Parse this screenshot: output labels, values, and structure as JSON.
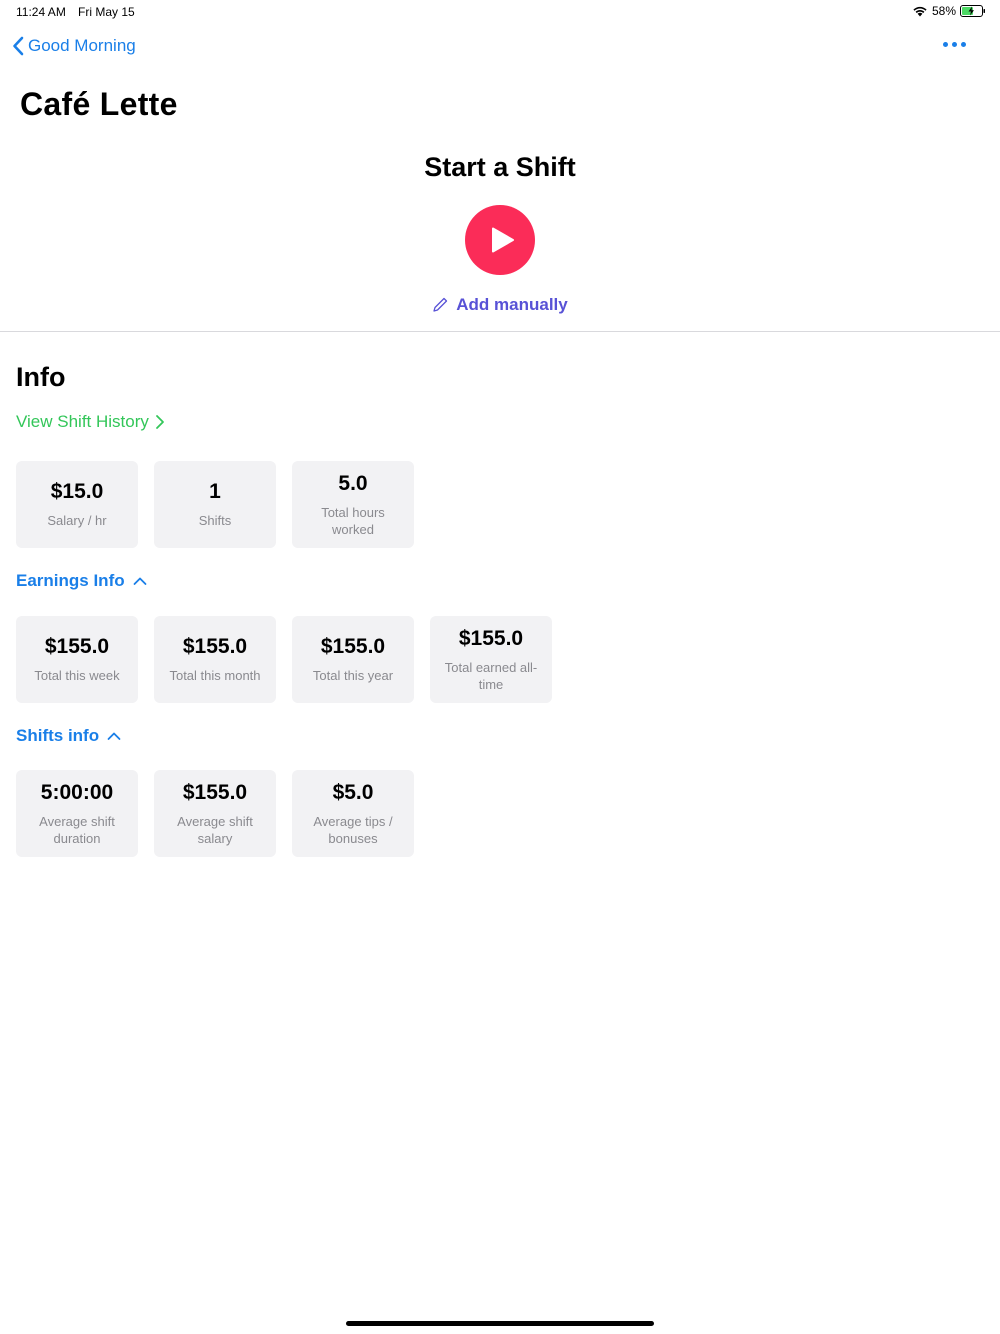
{
  "status_bar": {
    "time": "11:24 AM",
    "date": "Fri May 15",
    "battery": "58%"
  },
  "nav": {
    "back_label": "Good Morning"
  },
  "page_title": "Café  Lette",
  "shift": {
    "title": "Start a Shift",
    "add_manually": "Add manually"
  },
  "info": {
    "title": "Info",
    "history_link": "View Shift History",
    "cards": [
      {
        "value": "$15.0",
        "label": "Salary / hr"
      },
      {
        "value": "1",
        "label": "Shifts"
      },
      {
        "value": "5.0",
        "label": "Total hours worked"
      }
    ]
  },
  "earnings": {
    "title": "Earnings Info",
    "cards": [
      {
        "value": "$155.0",
        "label": "Total this week"
      },
      {
        "value": "$155.0",
        "label": "Total this month"
      },
      {
        "value": "$155.0",
        "label": "Total this year"
      },
      {
        "value": "$155.0",
        "label": "Total earned all-time"
      }
    ]
  },
  "shifts_info": {
    "title": "Shifts info",
    "cards": [
      {
        "value": "5:00:00",
        "label": "Average shift duration"
      },
      {
        "value": "$155.0",
        "label": "Average shift salary"
      },
      {
        "value": "$5.0",
        "label": "Average tips / bonuses"
      }
    ]
  },
  "colors": {
    "accent_blue": "#1a7fe8",
    "play_red": "#fb2c58",
    "link_green": "#33c659",
    "add_purple": "#5852d6"
  }
}
